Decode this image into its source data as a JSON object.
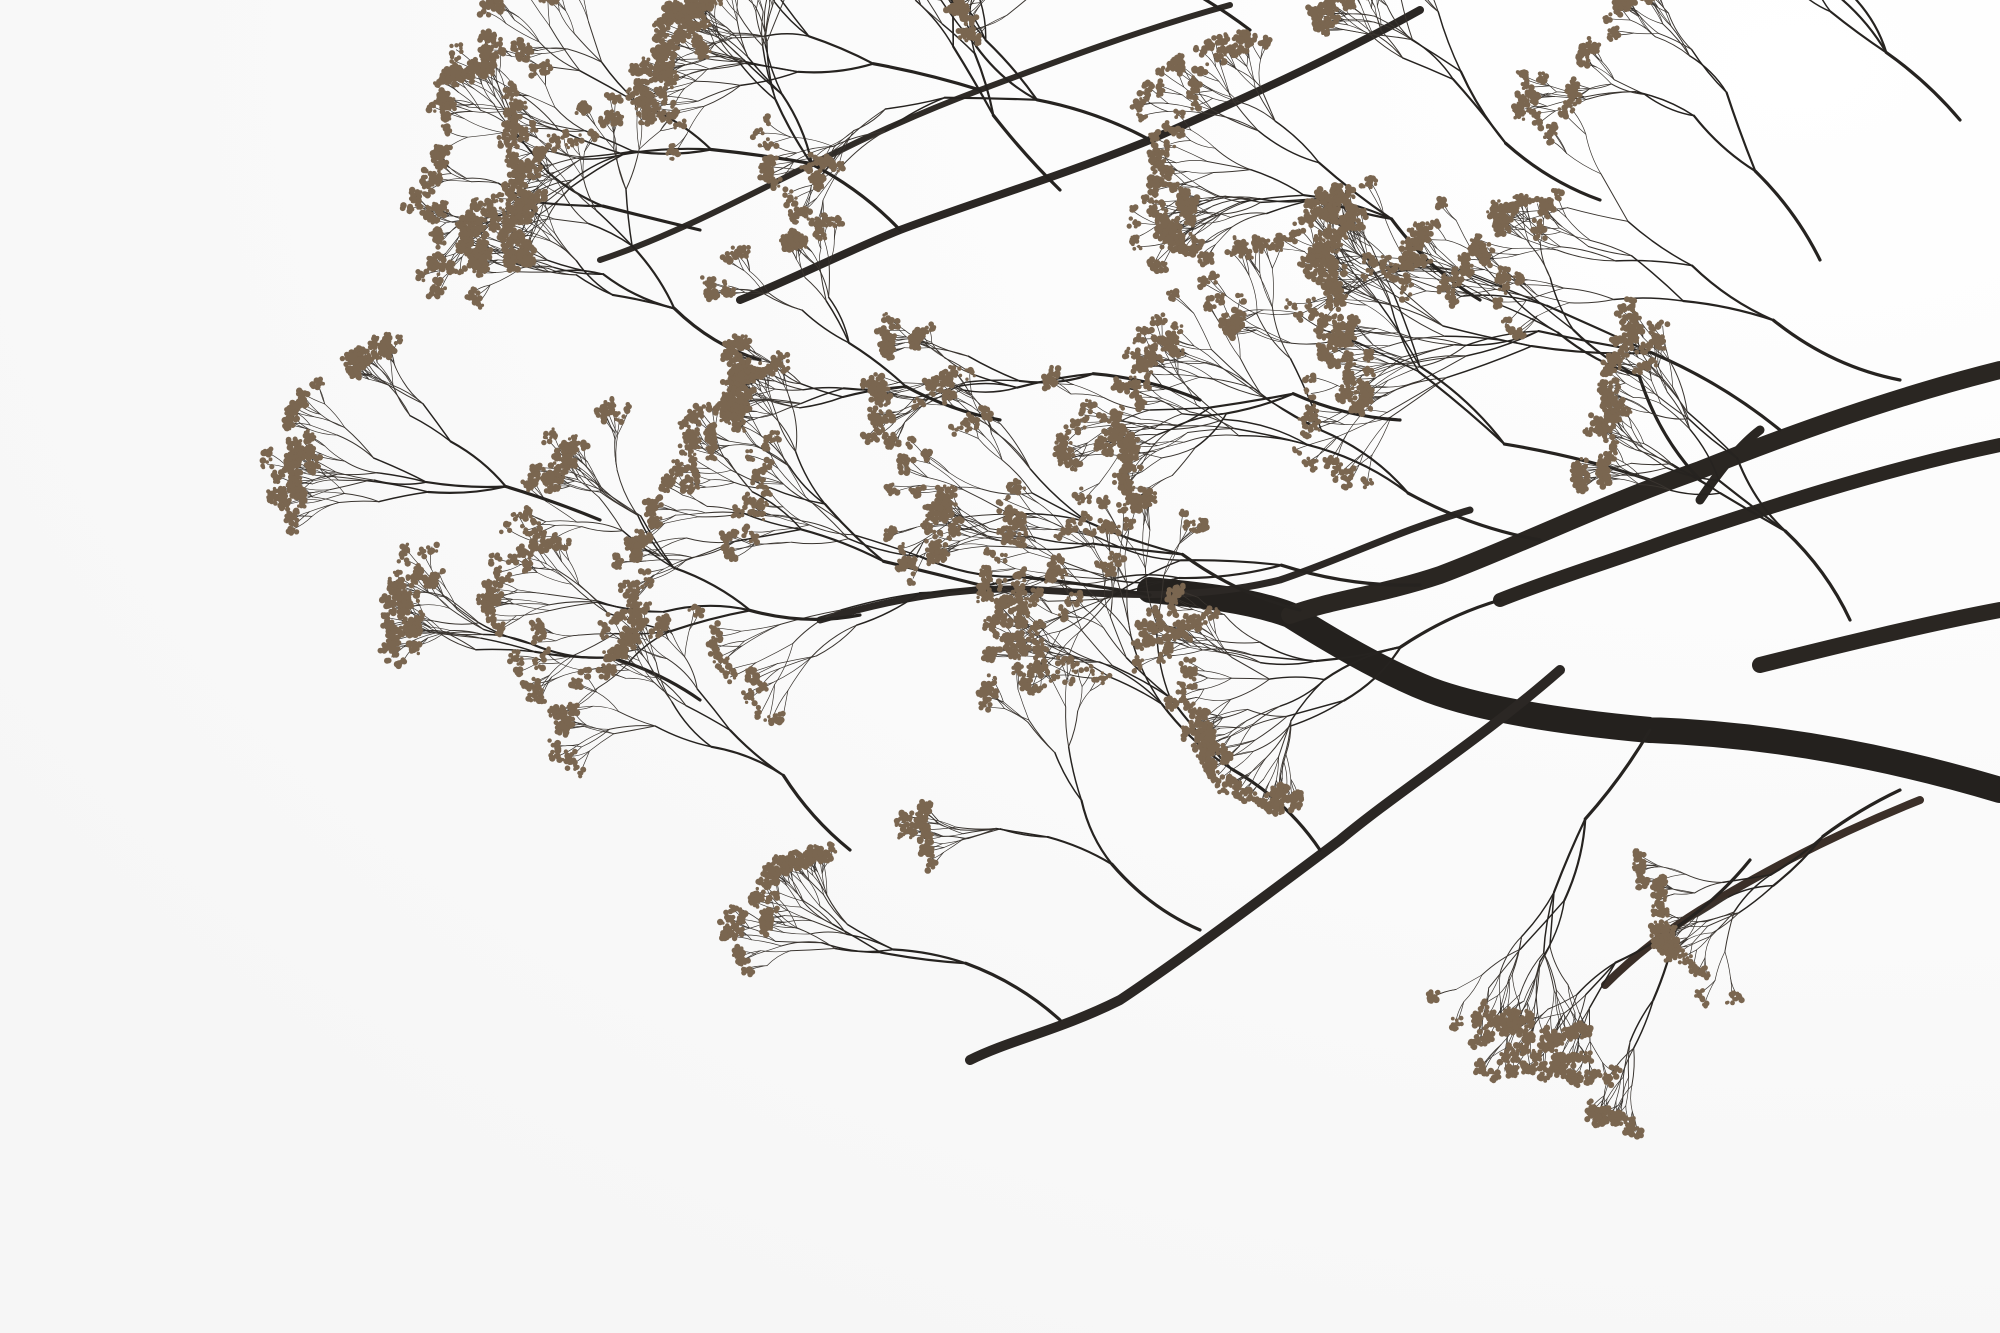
{
  "scene": {
    "subject": "bare-tree-branches",
    "colors": {
      "sky": "#ffffff",
      "haze": "#f4f4f4",
      "branch": "#262320",
      "twig": "#3a3530",
      "bud": "#7a6650"
    }
  }
}
